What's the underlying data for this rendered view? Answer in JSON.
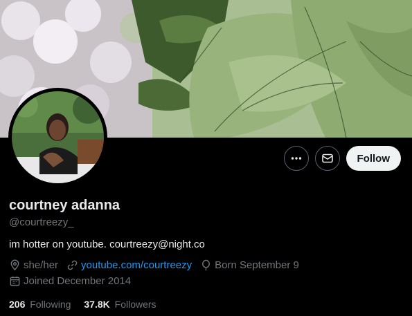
{
  "profile": {
    "display_name": "courtney adanna",
    "handle": "@courtreezy_",
    "bio": "im hotter on youtube. courtreezy@night.co",
    "pronouns": "she/her",
    "website": "youtube.com/courtreezy",
    "birthday": "Born September 9",
    "joined": "Joined December 2014"
  },
  "stats": {
    "following_count": "206",
    "following_label": "Following",
    "followers_count": "37.8K",
    "followers_label": "Followers"
  },
  "actions": {
    "follow_label": "Follow"
  },
  "icons": {
    "more": "more-icon",
    "message": "mail-icon",
    "location": "location-icon",
    "link": "link-icon",
    "birthday": "balloon-icon",
    "calendar": "calendar-icon"
  },
  "colors": {
    "background": "#000000",
    "primary_text": "#e7e9ea",
    "secondary_text": "#71767b",
    "link": "#1d9bf0",
    "follow_button_bg": "#eff3f4"
  }
}
